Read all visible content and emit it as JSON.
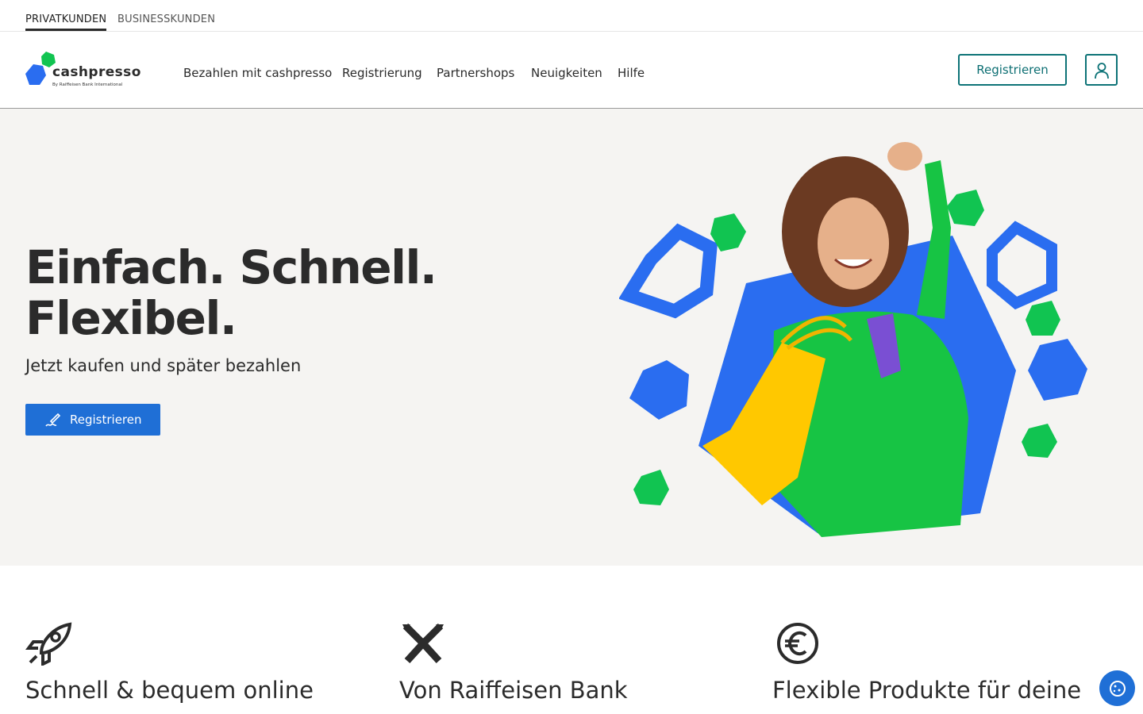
{
  "segments": {
    "private": "PRIVATKUNDEN",
    "business": "BUSINESSKUNDEN"
  },
  "logo": {
    "word": "cashpresso",
    "sub": "By Raiffeisen Bank International"
  },
  "nav": {
    "items": [
      "Bezahlen mit cashpresso",
      "Registrierung",
      "Partnershops",
      "Neuigkeiten",
      "Hilfe"
    ]
  },
  "header": {
    "register_label": "Registrieren"
  },
  "hero": {
    "title_line1": "Einfach. Schnell.",
    "title_line2": "Flexibel.",
    "subtitle": "Jetzt kaufen und später bezahlen",
    "cta_label": "Registrieren"
  },
  "features": [
    {
      "icon": "rocket-icon",
      "title": "Schnell & bequem online"
    },
    {
      "icon": "raiffeisen-icon",
      "title": "Von Raiffeisen Bank"
    },
    {
      "icon": "euro-icon",
      "title": "Flexible Produkte für deine"
    }
  ],
  "colors": {
    "brand_blue": "#1f6fd6",
    "brand_green": "#11c451",
    "teal": "#0d7377",
    "hero_bg": "#f5f4f2"
  }
}
